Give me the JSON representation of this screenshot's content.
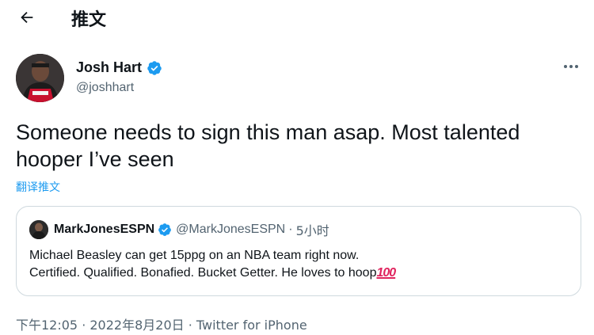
{
  "header": {
    "back_icon": "arrow-left-icon",
    "title": "推文"
  },
  "tweet": {
    "author_name": "Josh Hart",
    "author_handle": "@joshhart",
    "verified": true,
    "more_icon": "more-horizontal-icon",
    "text_lines": [
      "Someone needs to sign this man asap. Most talented",
      "hooper I’ve seen"
    ],
    "translate_label": "翻译推文",
    "timestamp": "下午12:05 · 2022年8月20日 · Twitter for iPhone"
  },
  "quoted": {
    "author_name": "MarkJonesESPN",
    "author_handle": "@MarkJonesESPN",
    "separator": "·",
    "time": "5小时",
    "text_lines": [
      "Michael Beasley can get 15ppg on an NBA team right now.",
      "Certified. Qualified. Bonafied. Bucket Getter. He loves to hoop"
    ],
    "emoji": "100",
    "emoji_icon": "hundred-points-emoji-icon"
  },
  "colors": {
    "text": "#0f1419",
    "secondary": "#536471",
    "accent": "#1d9bf0",
    "border": "#cfd9de",
    "verified": "#1d9bf0",
    "emoji": "#e0245e"
  }
}
